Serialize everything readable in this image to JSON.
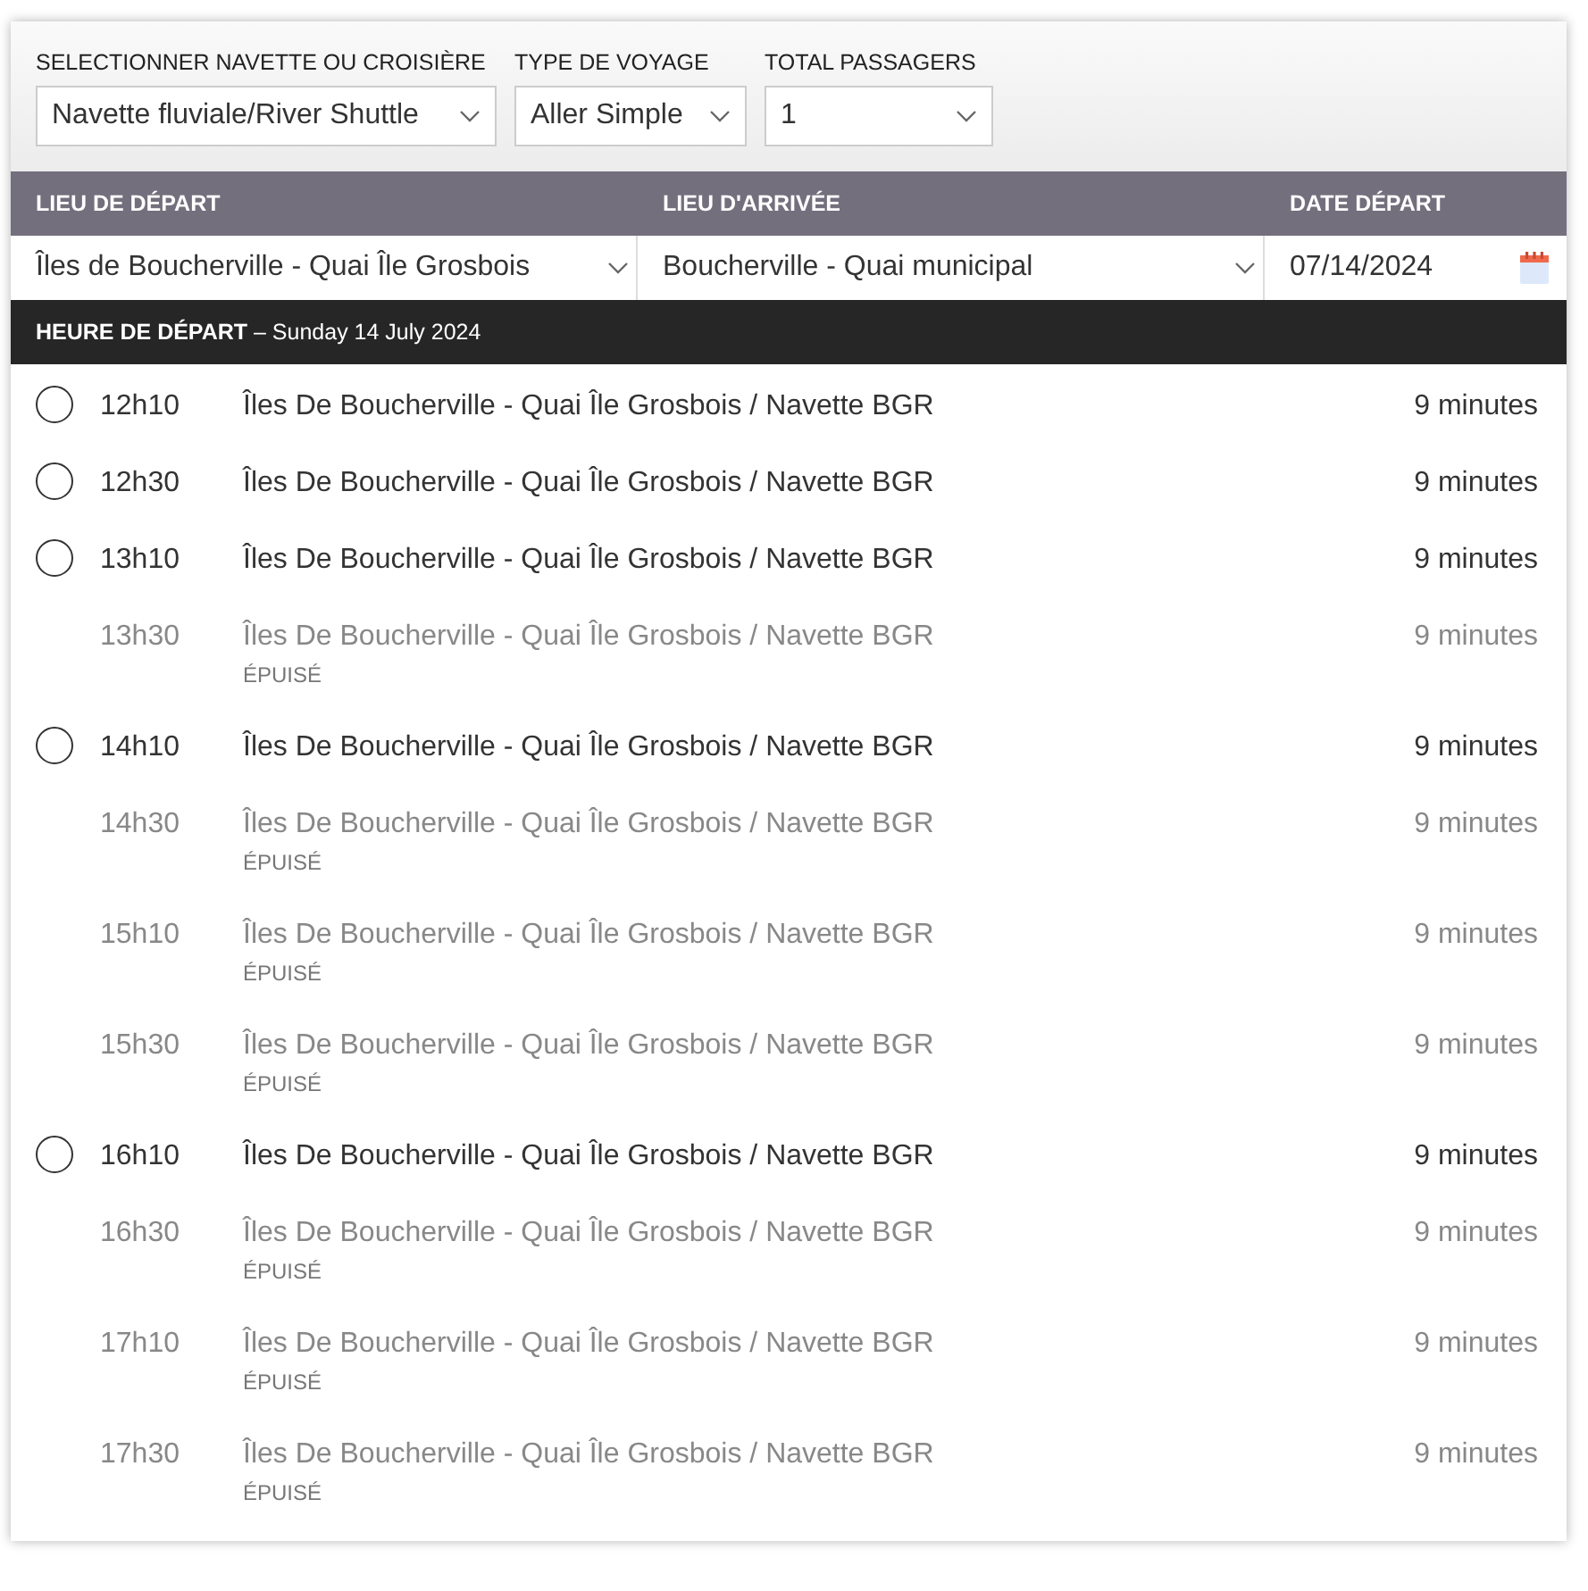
{
  "filters": [
    {
      "label": "SELECTIONNER NAVETTE OU CROISIÈRE",
      "value": "Navette fluviale/River Shuttle"
    },
    {
      "label": "TYPE DE VOYAGE",
      "value": "Aller Simple"
    },
    {
      "label": "TOTAL PASSAGERS",
      "value": "1"
    }
  ],
  "route": {
    "columns": [
      "LIEU DE DÉPART",
      "LIEU D'ARRIVÉE",
      "DATE DÉPART"
    ],
    "departure": "Îles de Boucherville - Quai Île Grosbois",
    "arrival": "Boucherville - Quai municipal",
    "date": "07/14/2024"
  },
  "schedule": {
    "title": "HEURE DE DÉPART",
    "date": "Sunday 14 July 2024",
    "separator": "–",
    "departures": [
      {
        "time": "12h10",
        "route": "Îles De Boucherville - Quai Île Grosbois / Navette BGR",
        "duration": "9 minutes",
        "disabled": false,
        "selected": false
      },
      {
        "time": "12h30",
        "route": "Îles De Boucherville - Quai Île Grosbois / Navette BGR",
        "duration": "9 minutes",
        "disabled": false,
        "selected": false
      },
      {
        "time": "13h10",
        "route": "Îles De Boucherville - Quai Île Grosbois / Navette BGR",
        "duration": "9 minutes",
        "disabled": false,
        "selected": false
      },
      {
        "time": "13h30",
        "route": "Îles De Boucherville - Quai Île Grosbois / Navette BGR",
        "duration": "9 minutes",
        "disabled": true,
        "status": "ÉPUISÉ"
      },
      {
        "time": "14h10",
        "route": "Îles De Boucherville - Quai Île Grosbois / Navette BGR",
        "duration": "9 minutes",
        "disabled": false,
        "selected": false
      },
      {
        "time": "14h30",
        "route": "Îles De Boucherville - Quai Île Grosbois / Navette BGR",
        "duration": "9 minutes",
        "disabled": true,
        "status": "ÉPUISÉ"
      },
      {
        "time": "15h10",
        "route": "Îles De Boucherville - Quai Île Grosbois / Navette BGR",
        "duration": "9 minutes",
        "disabled": true,
        "status": "ÉPUISÉ"
      },
      {
        "time": "15h30",
        "route": "Îles De Boucherville - Quai Île Grosbois / Navette BGR",
        "duration": "9 minutes",
        "disabled": true,
        "status": "ÉPUISÉ"
      },
      {
        "time": "16h10",
        "route": "Îles De Boucherville - Quai Île Grosbois / Navette BGR",
        "duration": "9 minutes",
        "disabled": false,
        "selected": false
      },
      {
        "time": "16h30",
        "route": "Îles De Boucherville - Quai Île Grosbois / Navette BGR",
        "duration": "9 minutes",
        "disabled": true,
        "status": "ÉPUISÉ"
      },
      {
        "time": "17h10",
        "route": "Îles De Boucherville - Quai Île Grosbois / Navette BGR",
        "duration": "9 minutes",
        "disabled": true,
        "status": "ÉPUISÉ"
      },
      {
        "time": "17h30",
        "route": "Îles De Boucherville - Quai Île Grosbois / Navette BGR",
        "duration": "9 minutes",
        "disabled": true,
        "status": "ÉPUISÉ"
      }
    ]
  }
}
